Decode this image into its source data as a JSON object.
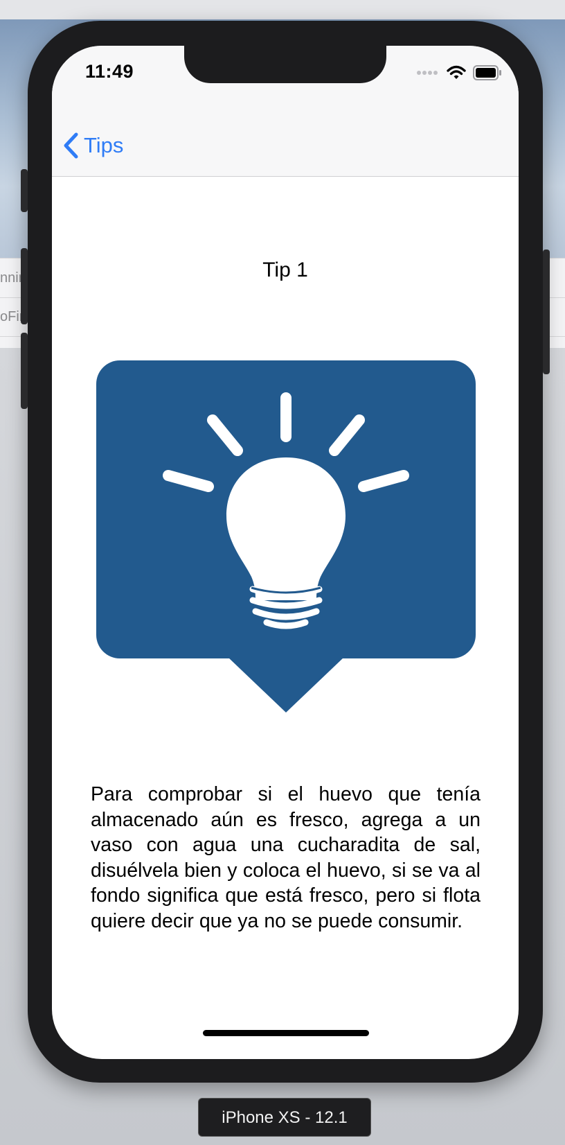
{
  "status_bar": {
    "time": "11:49"
  },
  "nav": {
    "back_label": "Tips"
  },
  "tip": {
    "title": "Tip 1",
    "image_icon": "lightbulb-speech-bubble-icon",
    "text": "Para comprobar si el huevo que tenía almacenado aún es fresco, agrega a un vaso con agua una cucharadita de sal, disuélvela bien y coloca el huevo, si se va al fondo significa que está fresco, pero si flota quiere decir que ya no se puede consumir."
  },
  "desktop": {
    "row1_fragment": "nnir",
    "row2_fragment": "oFir"
  },
  "simulator": {
    "device_label": "iPhone XS - 12.1"
  },
  "colors": {
    "accent": "#2f7cf6",
    "tip_bubble": "#225a8e"
  }
}
